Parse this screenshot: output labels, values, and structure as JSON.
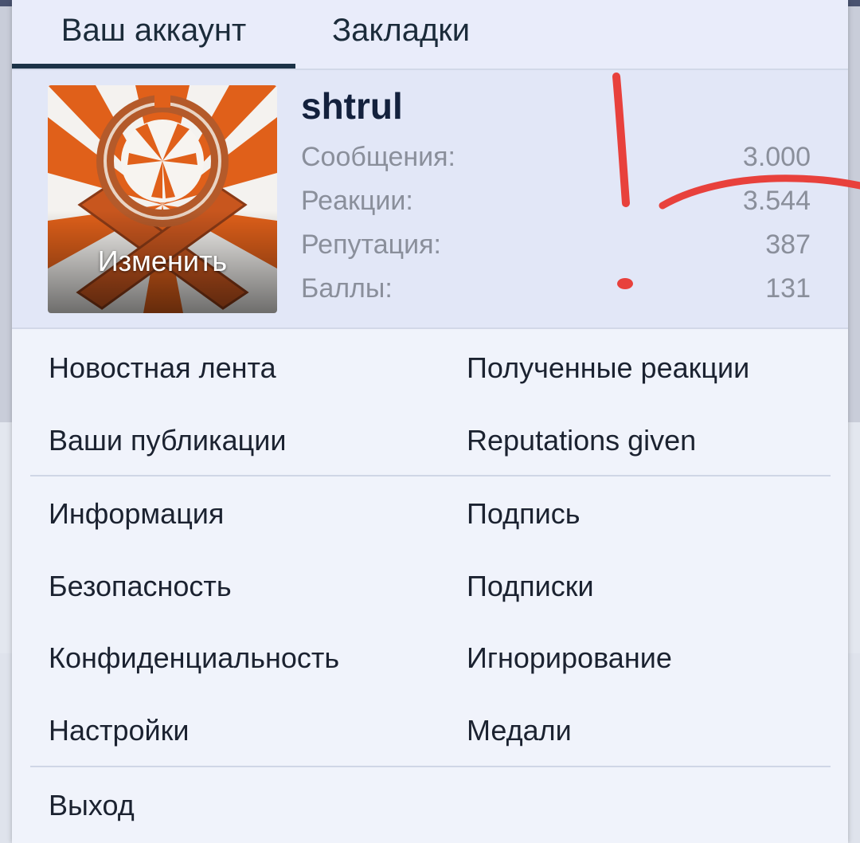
{
  "tabs": {
    "account": "Ваш аккаунт",
    "bookmarks": "Закладки"
  },
  "profile": {
    "username": "shtrul",
    "avatar_edit_label": "Изменить",
    "stats": [
      {
        "label": "Сообщения:",
        "value": "3.000"
      },
      {
        "label": "Реакции:",
        "value": "3.544"
      },
      {
        "label": "Репутация:",
        "value": "387"
      },
      {
        "label": "Баллы:",
        "value": "131"
      }
    ]
  },
  "menu": {
    "group1": {
      "left": [
        "Новостная лента",
        "Ваши публикации"
      ],
      "right": [
        "Полученные реакции",
        "Reputations given"
      ]
    },
    "group2": {
      "left": [
        "Информация",
        "Безопасность",
        "Конфиденциальность",
        "Настройки"
      ],
      "right": [
        "Подпись",
        "Подписки",
        "Игнорирование",
        "Медали"
      ]
    },
    "logout": "Выход"
  },
  "colors": {
    "popup_bg": "#f0f3fb",
    "profile_bg": "#e2e7f7",
    "tab_underline": "#1c3247",
    "scribble": "#e8413c",
    "avatar_orange": "#e0601a"
  }
}
